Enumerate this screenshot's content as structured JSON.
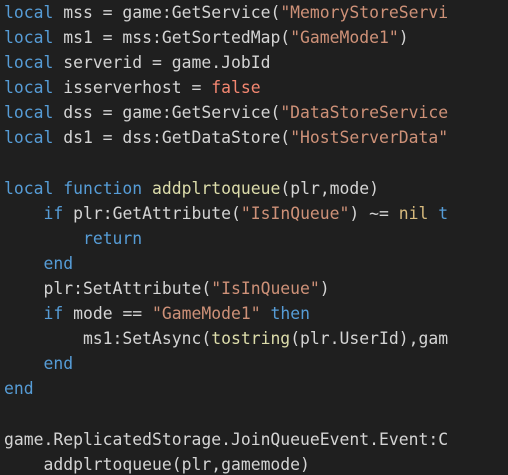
{
  "theme": {
    "background": "#1f1f1f",
    "colors": {
      "keyword": "#569cd6",
      "control": "#c586c0",
      "function": "#dcdcaa",
      "string": "#ce9178",
      "plain": "#d4d4d4",
      "bool": "#f48771",
      "builtin": "#dcdcaa",
      "nil": "#d7ba7d"
    }
  },
  "code": {
    "lines": [
      [
        [
          "kw",
          "local"
        ],
        [
          "pl",
          " mss = game:GetService("
        ],
        [
          "st",
          "\"MemoryStoreServi"
        ]
      ],
      [
        [
          "kw",
          "local"
        ],
        [
          "pl",
          " ms1 = mss:GetSortedMap("
        ],
        [
          "st",
          "\"GameMode1\""
        ],
        [
          "pl",
          ")"
        ]
      ],
      [
        [
          "kw",
          "local"
        ],
        [
          "pl",
          " serverid = game.JobId"
        ]
      ],
      [
        [
          "kw",
          "local"
        ],
        [
          "pl",
          " isserverhost = "
        ],
        [
          "bo",
          "false"
        ]
      ],
      [
        [
          "kw",
          "local"
        ],
        [
          "pl",
          " dss = game:GetService("
        ],
        [
          "st",
          "\"DataStoreService"
        ]
      ],
      [
        [
          "kw",
          "local"
        ],
        [
          "pl",
          " ds1 = dss:GetDataStore("
        ],
        [
          "st",
          "\"HostServerData\""
        ]
      ],
      [],
      [
        [
          "kw",
          "local"
        ],
        [
          "pl",
          " "
        ],
        [
          "kw",
          "function"
        ],
        [
          "pl",
          " "
        ],
        [
          "fn",
          "addplrtoqueue"
        ],
        [
          "pl",
          "(plr,mode)"
        ]
      ],
      [
        [
          "pl",
          "    "
        ],
        [
          "kw",
          "if"
        ],
        [
          "pl",
          " plr:GetAttribute("
        ],
        [
          "st",
          "\"IsInQueue\""
        ],
        [
          "pl",
          ") ~= "
        ],
        [
          "ni",
          "nil"
        ],
        [
          "pl",
          " "
        ],
        [
          "kw",
          "t"
        ]
      ],
      [
        [
          "pl",
          "        "
        ],
        [
          "kw",
          "return"
        ]
      ],
      [
        [
          "pl",
          "    "
        ],
        [
          "kw",
          "end"
        ]
      ],
      [
        [
          "pl",
          "    plr:SetAttribute("
        ],
        [
          "st",
          "\"IsInQueue\""
        ],
        [
          "pl",
          ")"
        ]
      ],
      [
        [
          "pl",
          "    "
        ],
        [
          "kw",
          "if"
        ],
        [
          "pl",
          " mode == "
        ],
        [
          "st",
          "\"GameMode1\""
        ],
        [
          "pl",
          " "
        ],
        [
          "kw",
          "then"
        ]
      ],
      [
        [
          "pl",
          "        ms1:SetAsync("
        ],
        [
          "bi",
          "tostring"
        ],
        [
          "pl",
          "(plr.UserId),gam"
        ]
      ],
      [
        [
          "pl",
          "    "
        ],
        [
          "kw",
          "end"
        ]
      ],
      [
        [
          "kw",
          "end"
        ]
      ],
      [],
      [
        [
          "pl",
          "game.ReplicatedStorage.JoinQueueEvent.Event:C"
        ]
      ],
      [
        [
          "pl",
          "    addplrtoqueue(plr,gamemode)"
        ]
      ]
    ]
  }
}
